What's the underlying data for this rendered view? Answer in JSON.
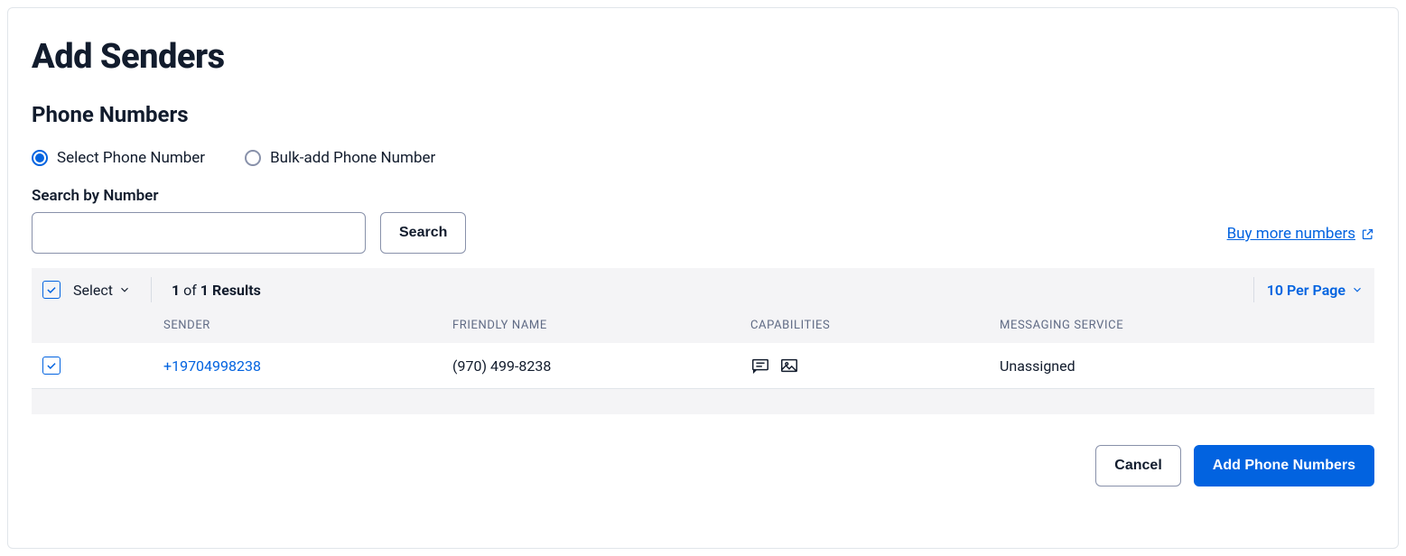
{
  "page_title": "Add Senders",
  "section_title": "Phone Numbers",
  "radios": {
    "select_label": "Select Phone Number",
    "bulk_label": "Bulk-add Phone Number"
  },
  "search": {
    "label": "Search by Number",
    "value": "",
    "button": "Search"
  },
  "buy_link": "Buy more numbers",
  "toolbar": {
    "select_label": "Select",
    "results_current": "1",
    "results_of": "of",
    "results_total": "1 Results",
    "per_page": "10 Per Page"
  },
  "columns": {
    "sender": "SENDER",
    "friendly": "FRIENDLY NAME",
    "caps": "CAPABILITIES",
    "service": "MESSAGING SERVICE"
  },
  "rows": [
    {
      "sender": "+19704998238",
      "friendly": "(970) 499-8238",
      "service": "Unassigned",
      "capabilities": [
        "sms",
        "mms"
      ]
    }
  ],
  "actions": {
    "cancel": "Cancel",
    "add": "Add Phone Numbers"
  }
}
